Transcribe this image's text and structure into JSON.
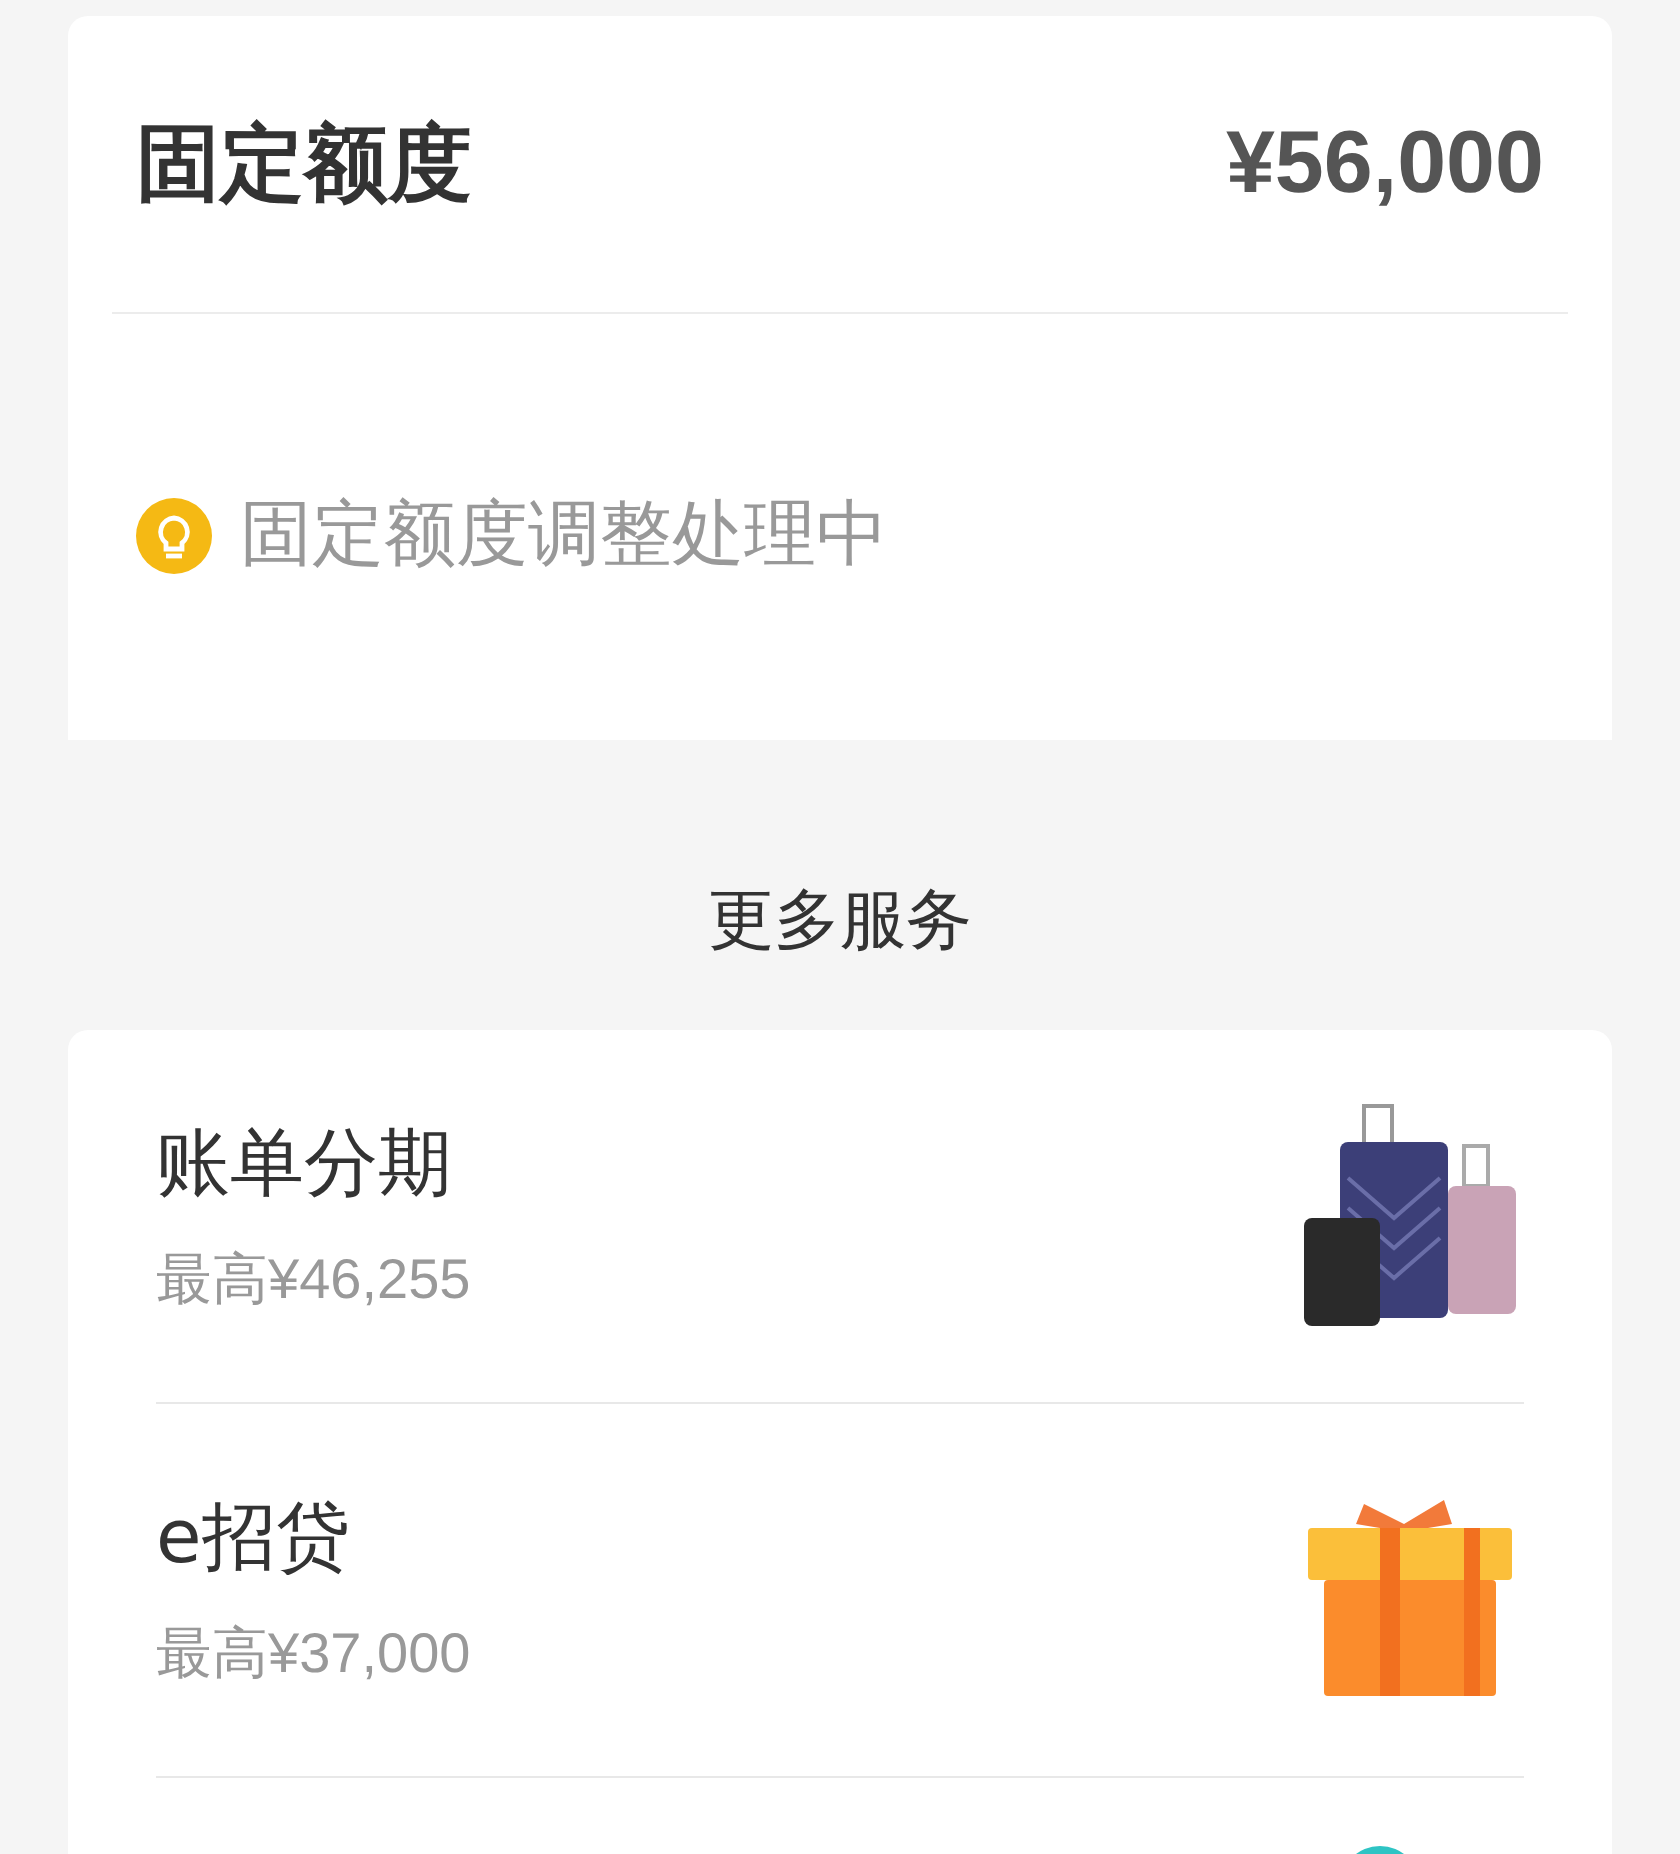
{
  "quota_card": {
    "title": "固定额度",
    "amount": "¥56,000",
    "notice": "固定额度调整处理中"
  },
  "section_title": "更多服务",
  "services": [
    {
      "kind": "luggage",
      "title": "账单分期",
      "subtitle": "最高¥46,255"
    },
    {
      "kind": "gift",
      "title": "e招贷",
      "subtitle": "最高¥37,000"
    },
    {
      "kind": "teal"
    }
  ]
}
